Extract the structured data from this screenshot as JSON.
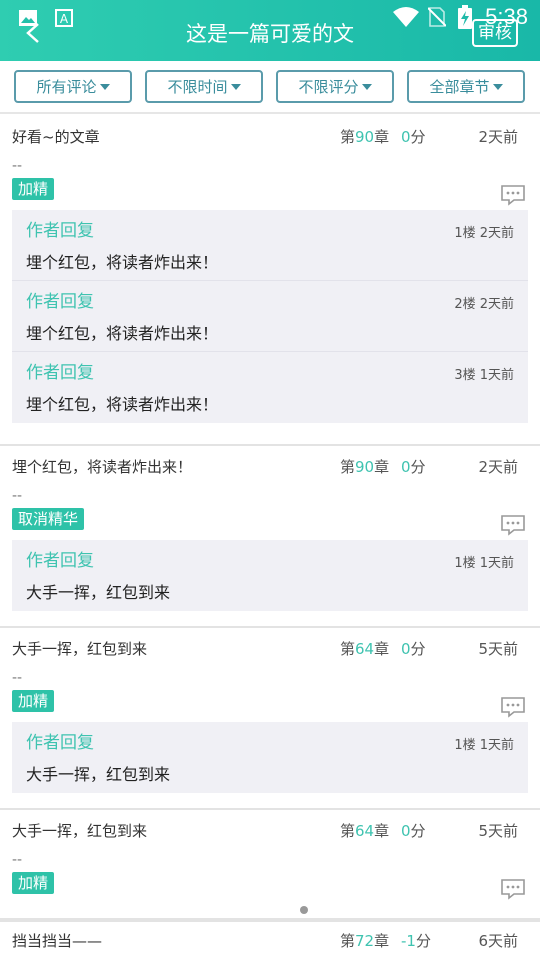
{
  "status_bar": {
    "time": "5:38",
    "left_icons": [
      "image-icon",
      "font-icon"
    ],
    "right_icons": [
      "wifi-icon",
      "no-sim-icon",
      "battery-charging-icon"
    ]
  },
  "header": {
    "title": "这是一篇可爱的文",
    "review_label": "审核",
    "back_icon": "back-arrow-icon"
  },
  "filters": [
    {
      "label": "所有评论"
    },
    {
      "label": "不限时间"
    },
    {
      "label": "不限评分"
    },
    {
      "label": "全部章节"
    }
  ],
  "labels": {
    "chapter_prefix": "第",
    "chapter_suffix": "章",
    "score_suffix": "分",
    "dash": "--"
  },
  "comments": [
    {
      "text": "好看~的文章",
      "chapter": "90",
      "score": "0",
      "date": "2天前",
      "tag": "加精",
      "replies": [
        {
          "author": "作者回复",
          "meta": "1楼 2天前",
          "text": "埋个红包，将读者炸出来！"
        },
        {
          "author": "作者回复",
          "meta": "2楼 2天前",
          "text": "埋个红包，将读者炸出来！"
        },
        {
          "author": "作者回复",
          "meta": "3楼 1天前",
          "text": "埋个红包，将读者炸出来！"
        }
      ]
    },
    {
      "text": "埋个红包，将读者炸出来！",
      "chapter": "90",
      "score": "0",
      "date": "2天前",
      "tag": "取消精华",
      "replies": [
        {
          "author": "作者回复",
          "meta": "1楼 1天前",
          "text": "大手一挥，红包到来"
        }
      ]
    },
    {
      "text": "大手一挥，红包到来",
      "chapter": "64",
      "score": "0",
      "date": "5天前",
      "tag": "加精",
      "replies": [
        {
          "author": "作者回复",
          "meta": "1楼 1天前",
          "text": "大手一挥，红包到来"
        }
      ]
    },
    {
      "text": "大手一挥，红包到来",
      "chapter": "64",
      "score": "0",
      "date": "5天前",
      "tag": "加精",
      "replies": []
    },
    {
      "text": "挡当挡当——",
      "chapter": "72",
      "score": "-1",
      "date": "6天前",
      "tag": "",
      "replies": []
    }
  ],
  "colors": {
    "accent": "#2ec2a8",
    "header_start": "#2fcdb1",
    "header_end": "#19b8a8",
    "filter_border": "#5a9bab"
  }
}
